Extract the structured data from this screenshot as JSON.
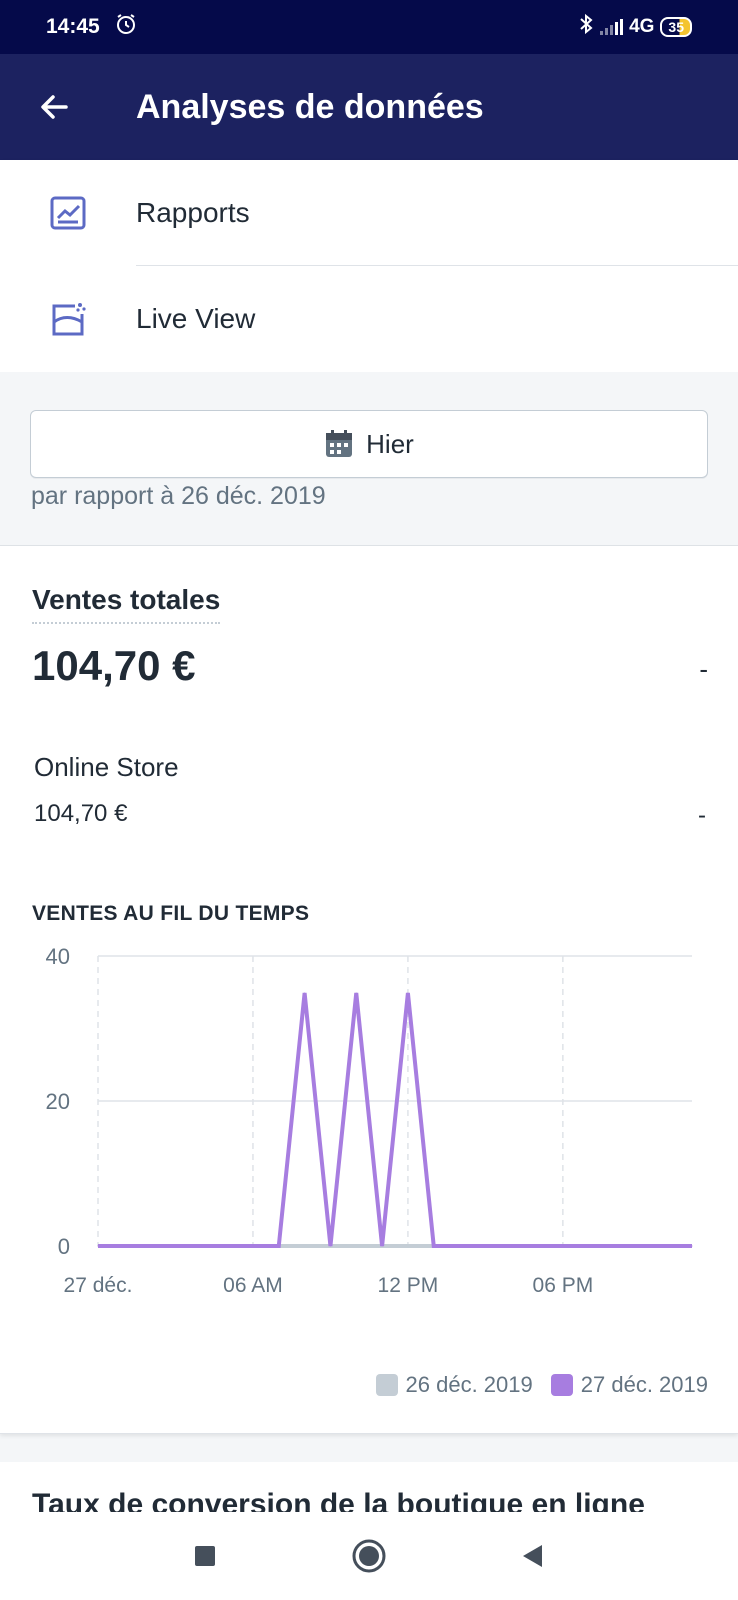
{
  "status_bar": {
    "time": "14:45",
    "network": "4G",
    "battery": "35"
  },
  "app_bar": {
    "title": "Analyses de données"
  },
  "menu": {
    "items": [
      {
        "label": "Rapports",
        "icon": "reports-chart-icon"
      },
      {
        "label": "Live View",
        "icon": "live-view-icon"
      }
    ]
  },
  "date_filter": {
    "label": "Hier",
    "comparison": "par rapport à 26 déc. 2019"
  },
  "sales": {
    "title": "Ventes totales",
    "total": "104,70 €",
    "total_change": "-",
    "channel_name": "Online Store",
    "channel_value": "104,70 €",
    "channel_change": "-",
    "chart_heading": "VENTES AU FIL DU TEMPS"
  },
  "chart_data": {
    "type": "line",
    "title": "VENTES AU FIL DU TEMPS",
    "x_tick_labels": [
      "27 déc.",
      "06 AM",
      "12 PM",
      "06 PM"
    ],
    "y_tick_labels": [
      "40",
      "20",
      "0"
    ],
    "ylim": [
      0,
      40
    ],
    "x": [
      0,
      1,
      2,
      3,
      4,
      5,
      6,
      7,
      8,
      9,
      10,
      11,
      12,
      13,
      14,
      15,
      16,
      17,
      18,
      19,
      20,
      21,
      22,
      23
    ],
    "series": [
      {
        "name": "26 déc. 2019",
        "color": "#c4cdd5",
        "values": [
          0,
          0,
          0,
          0,
          0,
          0,
          0,
          0,
          0,
          0,
          0,
          0,
          0,
          0,
          0,
          0,
          0,
          0,
          0,
          0,
          0,
          0,
          0,
          0
        ]
      },
      {
        "name": "27 déc. 2019",
        "color": "#a77de0",
        "values": [
          0,
          0,
          0,
          0,
          0,
          0,
          0,
          0,
          34.9,
          0,
          34.9,
          0,
          34.9,
          0,
          0,
          0,
          0,
          0,
          0,
          0,
          0,
          0,
          0,
          0
        ]
      }
    ],
    "grid": true,
    "legend_position": "bottom-right"
  },
  "next_section": {
    "title": "Taux de conversion de la boutique en ligne"
  }
}
